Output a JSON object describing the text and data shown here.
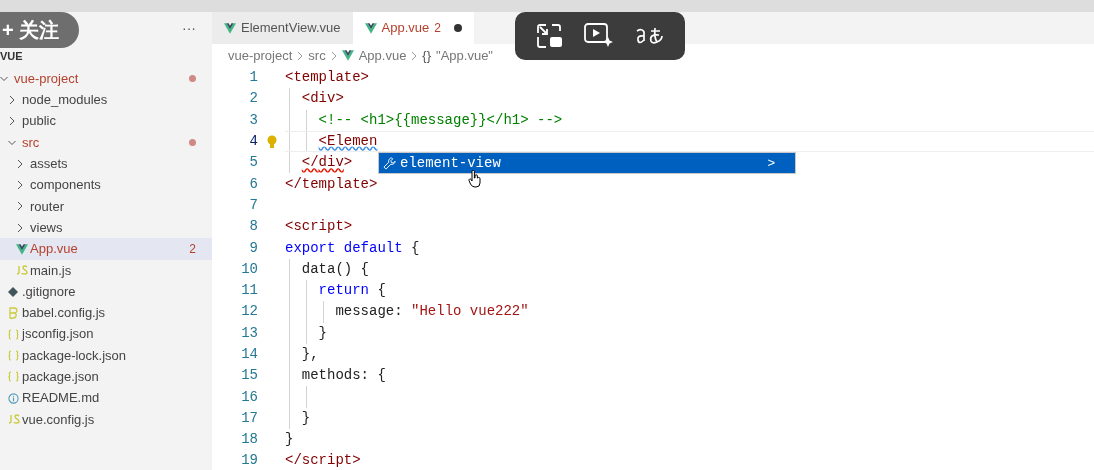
{
  "overlay_button": {
    "label": "+ 关注"
  },
  "sidebar": {
    "section_title": "VUE",
    "more": "···",
    "tree": [
      {
        "label": "vue-project",
        "kind": "folder",
        "expanded": true,
        "has_errors": true,
        "selected": false,
        "children": [
          {
            "label": "node_modules",
            "kind": "folder",
            "expanded": false,
            "has_errors": false,
            "selected": false
          },
          {
            "label": "public",
            "kind": "folder",
            "expanded": false,
            "has_errors": false,
            "selected": false
          },
          {
            "label": "src",
            "kind": "folder",
            "expanded": true,
            "has_errors": true,
            "selected": false,
            "children": [
              {
                "label": "assets",
                "kind": "folder",
                "expanded": false,
                "has_errors": false,
                "selected": false
              },
              {
                "label": "components",
                "kind": "folder",
                "expanded": false,
                "has_errors": false,
                "selected": false
              },
              {
                "label": "router",
                "kind": "folder",
                "expanded": false,
                "has_errors": false,
                "selected": false
              },
              {
                "label": "views",
                "kind": "folder",
                "expanded": false,
                "has_errors": false,
                "selected": false
              },
              {
                "label": "App.vue",
                "kind": "vue",
                "has_errors": true,
                "selected": true,
                "badge": "2"
              },
              {
                "label": "main.js",
                "kind": "js",
                "has_errors": false,
                "selected": false
              }
            ]
          },
          {
            "label": ".gitignore",
            "kind": "git",
            "has_errors": false,
            "selected": false
          },
          {
            "label": "babel.config.js",
            "kind": "babel",
            "has_errors": false,
            "selected": false
          },
          {
            "label": "jsconfig.json",
            "kind": "json",
            "has_errors": false,
            "selected": false
          },
          {
            "label": "package-lock.json",
            "kind": "json",
            "has_errors": false,
            "selected": false
          },
          {
            "label": "package.json",
            "kind": "json",
            "has_errors": false,
            "selected": false
          },
          {
            "label": "README.md",
            "kind": "info",
            "has_errors": false,
            "selected": false
          },
          {
            "label": "vue.config.js",
            "kind": "js",
            "has_errors": false,
            "selected": false
          }
        ]
      }
    ]
  },
  "tabs": [
    {
      "label": "ElementView.vue",
      "selected": false,
      "modified": false,
      "has_errors": false
    },
    {
      "label": "App.vue",
      "selected": true,
      "modified": true,
      "has_errors": true,
      "badge": "2"
    }
  ],
  "breadcrumb": [
    {
      "label": "vue-project",
      "kind": "text"
    },
    {
      "label": "src",
      "kind": "text"
    },
    {
      "label": "App.vue",
      "kind": "vue"
    },
    {
      "label": "\"App.vue\"",
      "kind": "braces",
      "braces": "{}"
    }
  ],
  "editor": {
    "lines": [
      {
        "number": "1",
        "current": false,
        "tokens": [
          {
            "text": "<template>",
            "kind": "tag"
          }
        ],
        "children": [
          {
            "number": "2",
            "current": false,
            "tokens": [
              {
                "text": "<div>",
                "kind": "tag"
              }
            ],
            "children": [
              {
                "number": "3",
                "current": false,
                "tokens": [
                  {
                    "text": "<!-- <h1>{{message}}</h1> -->",
                    "kind": "comment"
                  }
                ]
              },
              {
                "number": "4",
                "current": true,
                "lightbulb": true,
                "tokens": [
                  {
                    "text": "<Elemen",
                    "kind": "tag",
                    "squiggle": true
                  }
                ]
              }
            ]
          },
          {
            "number": "5",
            "current": false,
            "tokens": [
              {
                "text": "</",
                "kind": "tag",
                "squiggle": true
              },
              {
                "text": "div",
                "kind": "tag",
                "squiggle": true
              },
              {
                "text": ">",
                "kind": "tag"
              }
            ]
          }
        ]
      },
      {
        "number": "6",
        "current": false,
        "tokens": [
          {
            "text": "</template>",
            "kind": "tag"
          }
        ]
      },
      {
        "number": "7",
        "current": false
      },
      {
        "number": "8",
        "current": false,
        "tokens": [
          {
            "text": "<script>",
            "kind": "tag"
          }
        ]
      },
      {
        "number": "9",
        "current": false,
        "tokens": [
          {
            "text": "export default",
            "kind": "keyword"
          },
          {
            "text": " {",
            "kind": "plain"
          }
        ],
        "children": [
          {
            "number": "10",
            "current": false,
            "tokens": [
              {
                "text": "data() {",
                "kind": "plain"
              }
            ],
            "children": [
              {
                "number": "11",
                "current": false,
                "tokens": [
                  {
                    "text": "return",
                    "kind": "keyword"
                  },
                  {
                    "text": " {",
                    "kind": "plain"
                  }
                ],
                "children": [
                  {
                    "number": "12",
                    "current": false,
                    "tokens": [
                      {
                        "text": "message: ",
                        "kind": "plain"
                      },
                      {
                        "text": "\"Hello vue222\"",
                        "kind": "string"
                      }
                    ]
                  }
                ]
              },
              {
                "number": "13",
                "current": false,
                "tokens": [
                  {
                    "text": "}",
                    "kind": "plain"
                  }
                ]
              }
            ]
          },
          {
            "number": "14",
            "current": false,
            "tokens": [
              {
                "text": "},",
                "kind": "plain"
              }
            ]
          },
          {
            "number": "15",
            "current": false,
            "tokens": [
              {
                "text": "methods: {",
                "kind": "plain"
              }
            ],
            "children": [
              {
                "number": "16",
                "current": false
              }
            ]
          },
          {
            "number": "17",
            "current": false,
            "tokens": [
              {
                "text": "}",
                "kind": "plain"
              }
            ]
          }
        ]
      },
      {
        "number": "18",
        "current": false,
        "tokens": [
          {
            "text": "}",
            "kind": "plain"
          }
        ]
      },
      {
        "number": "19",
        "current": false,
        "tokens": [
          {
            "text": "</script>",
            "kind": "tag"
          }
        ]
      }
    ],
    "suggestions": {
      "items": [
        {
          "label": "element-view",
          "selected": true
        }
      ],
      "details": ">"
    }
  }
}
